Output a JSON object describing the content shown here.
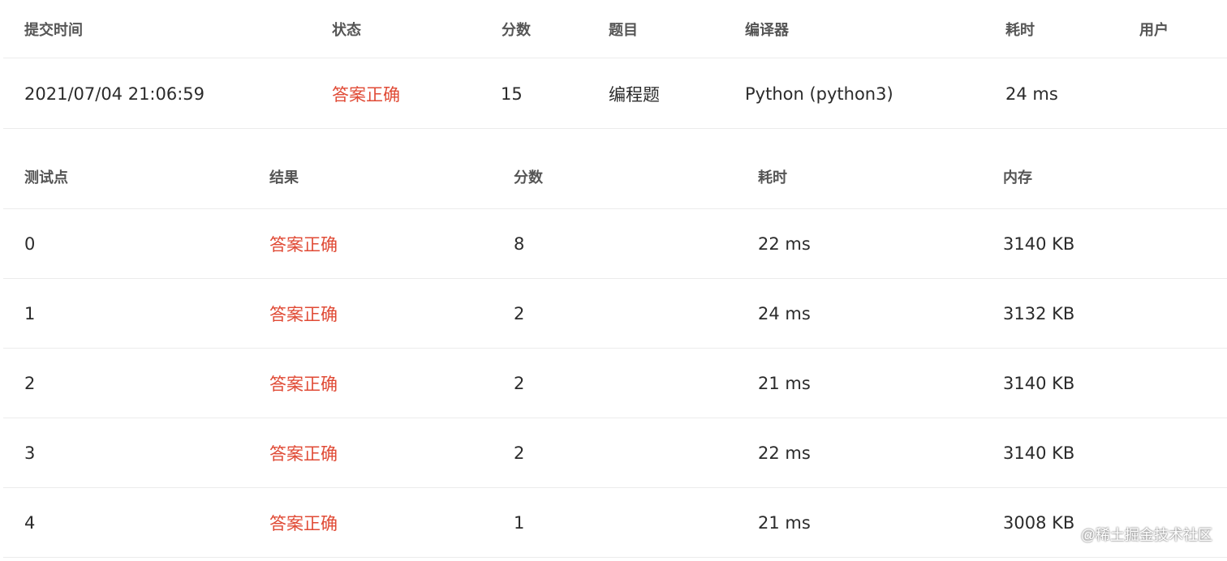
{
  "submission": {
    "headers": [
      "提交时间",
      "状态",
      "分数",
      "题目",
      "编译器",
      "耗时",
      "用户"
    ],
    "row": {
      "time": "2021/07/04 21:06:59",
      "status": "答案正确",
      "score": "15",
      "problem": "编程题",
      "compiler": "Python (python3)",
      "elapsed": "24 ms",
      "user": ""
    }
  },
  "tests": {
    "headers": [
      "测试点",
      "结果",
      "分数",
      "耗时",
      "内存"
    ],
    "rows": [
      {
        "id": "0",
        "result": "答案正确",
        "score": "8",
        "time": "22 ms",
        "memory": "3140 KB"
      },
      {
        "id": "1",
        "result": "答案正确",
        "score": "2",
        "time": "24 ms",
        "memory": "3132 KB"
      },
      {
        "id": "2",
        "result": "答案正确",
        "score": "2",
        "time": "21 ms",
        "memory": "3140 KB"
      },
      {
        "id": "3",
        "result": "答案正确",
        "score": "2",
        "time": "22 ms",
        "memory": "3140 KB"
      },
      {
        "id": "4",
        "result": "答案正确",
        "score": "1",
        "time": "21 ms",
        "memory": "3008 KB"
      }
    ]
  },
  "watermark": "@稀土掘金技术社区",
  "colors": {
    "status_ok": "#e04a35",
    "header_text": "#555555",
    "divider": "#ececec"
  }
}
